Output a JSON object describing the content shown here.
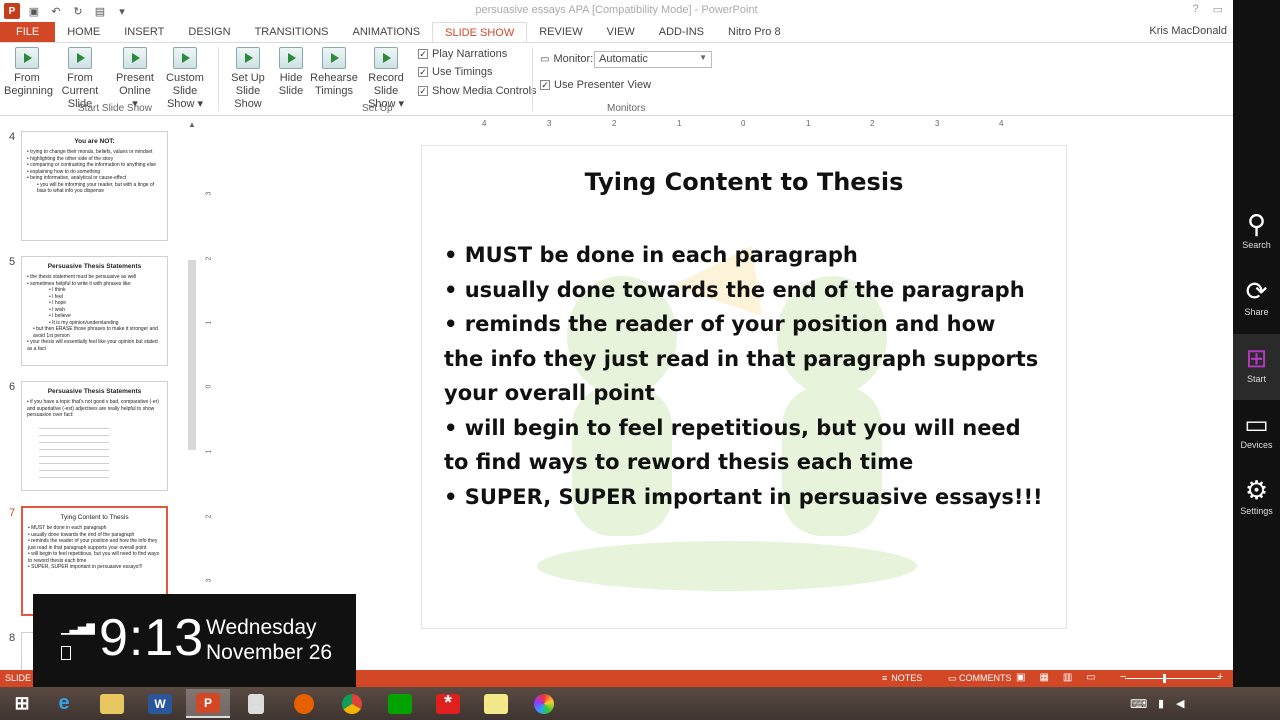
{
  "window": {
    "title": "persuasive essays APA [Compatibility Mode] - PowerPoint",
    "user": "Kris MacDonald"
  },
  "tabs": [
    {
      "label": "FILE"
    },
    {
      "label": "HOME"
    },
    {
      "label": "INSERT"
    },
    {
      "label": "DESIGN"
    },
    {
      "label": "TRANSITIONS"
    },
    {
      "label": "ANIMATIONS"
    },
    {
      "label": "SLIDE SHOW"
    },
    {
      "label": "REVIEW"
    },
    {
      "label": "VIEW"
    },
    {
      "label": "ADD-INS"
    },
    {
      "label": "Nitro Pro 8"
    }
  ],
  "ribbon": {
    "buttons": [
      {
        "line1": "From",
        "line2": "Beginning"
      },
      {
        "line1": "From",
        "line2": "Current Slide"
      },
      {
        "line1": "Present",
        "line2": "Online ▾"
      },
      {
        "line1": "Custom Slide",
        "line2": "Show ▾"
      },
      {
        "line1": "Set Up",
        "line2": "Slide Show"
      },
      {
        "line1": "Hide",
        "line2": "Slide"
      },
      {
        "line1": "Rehearse",
        "line2": "Timings"
      },
      {
        "line1": "Record Slide",
        "line2": "Show ▾"
      }
    ],
    "checkboxes": [
      {
        "label": "Play Narrations",
        "checked": true
      },
      {
        "label": "Use Timings",
        "checked": true
      },
      {
        "label": "Show Media Controls",
        "checked": true
      },
      {
        "label": "Use Presenter View",
        "checked": true
      }
    ],
    "monitor_label": "Monitor:",
    "monitor_value": "Automatic",
    "groups": [
      "Start Slide Show",
      "Set Up",
      "Monitors"
    ]
  },
  "thumbnails": [
    {
      "num": "4",
      "title": "You are NOT:",
      "lines": [
        "• trying to change their morals, beliefs, values or mindset",
        "• highlighting the other side of the story",
        "• comparing or contrasting the information to anything else",
        "• explaining how to do something",
        "• being informative, analytical or cause-effect",
        "• you will be informing your reader, but with a tinge of bias to what info you dispense"
      ]
    },
    {
      "num": "5",
      "title": "Persuasive Thesis Statements",
      "lines": [
        "• the thesis statement must be persuasive as well",
        "• sometimes helpful to write it with phrases like:",
        "• I think",
        "• I feel",
        "• I hope",
        "• I wish",
        "• I believe",
        "• It is my opinion/understanding",
        "• but then ERASE those phrases to make it stronger and avoid 1st person",
        "• your thesis will essentially feel like your opinion but stated as a fact"
      ]
    },
    {
      "num": "6",
      "title": "Persuasive Thesis Statements",
      "lines": [
        "• if you have a topic that's not good v bad, comparative (-er) and superlative (-est) adjectives are really helpful to show persuasion over fact:"
      ]
    },
    {
      "num": "7",
      "title": "Tying Content to Thesis",
      "lines": [
        "• MUST be done in each paragraph",
        "• usually done towards the end of the paragraph",
        "• reminds the reader of your position and how the info they just read in that paragraph supports your overall point",
        "• will begin to feel repetitious, but you will need to find ways to reword thesis each time",
        "• SUPER, SUPER important in persuasive essays!!!"
      ]
    },
    {
      "num": "8",
      "title": "",
      "lines": []
    }
  ],
  "hruler_labels": [
    "4",
    "3",
    "2",
    "1",
    "0",
    "1",
    "2",
    "3",
    "4"
  ],
  "vruler_labels": [
    "3",
    "2",
    "1",
    "0",
    "1",
    "2",
    "3"
  ],
  "slide": {
    "title": "Tying Content to Thesis",
    "lines": [
      "• MUST be done in each paragraph",
      "• usually done towards the end of the paragraph",
      "• reminds the reader of your position and how",
      "the info they just read in that paragraph supports",
      "your overall point",
      "• will begin to feel repetitious, but you will need",
      "to find ways to reword thesis each time",
      "• SUPER, SUPER important in persuasive essays!!!"
    ]
  },
  "status": {
    "slide": "SLIDE 7",
    "notes": "NOTES",
    "comments": "COMMENTS"
  },
  "charms": [
    {
      "label": "Search",
      "icon": "search-icon"
    },
    {
      "label": "Share",
      "icon": "share-icon"
    },
    {
      "label": "Start",
      "icon": "windows-icon"
    },
    {
      "label": "Devices",
      "icon": "devices-icon"
    },
    {
      "label": "Settings",
      "icon": "gear-icon"
    }
  ],
  "clock": {
    "time": "9:13",
    "day": "Wednesday",
    "date": "November 26"
  },
  "colors": {
    "accent": "#d24726",
    "start_charm": "#b637c0"
  }
}
